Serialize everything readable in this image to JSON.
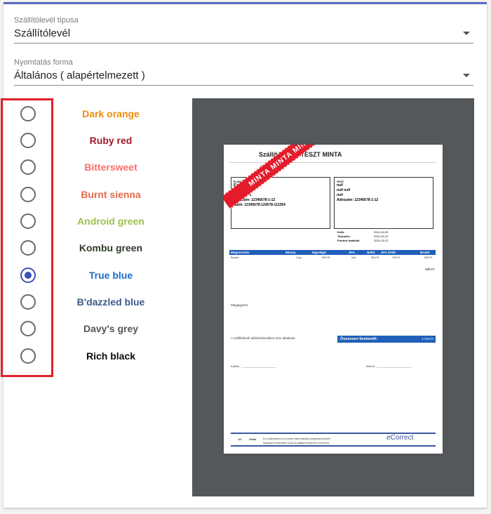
{
  "delivery_type": {
    "label": "Szállítólevél típusa",
    "value": "Szállítólevél"
  },
  "print_form": {
    "label": "Nyomtatás forma",
    "value": "Általános ( alapértelmezett )"
  },
  "colors": [
    {
      "label": "Dark orange",
      "color": "#f08a0b",
      "checked": false
    },
    {
      "label": "Ruby red",
      "color": "#9e1a2a",
      "checked": false
    },
    {
      "label": "Bittersweet",
      "color": "#fb6f6b",
      "checked": false
    },
    {
      "label": "Burnt sienna",
      "color": "#e66a4a",
      "checked": false
    },
    {
      "label": "Android green",
      "color": "#9bc34b",
      "checked": false
    },
    {
      "label": "Kombu green",
      "color": "#2e3b2a",
      "checked": false
    },
    {
      "label": "True blue",
      "color": "#1a6cc8",
      "checked": true
    },
    {
      "label": "B'dazzled blue",
      "color": "#3a5a8c",
      "checked": false
    },
    {
      "label": "Davy's grey",
      "color": "#555555",
      "checked": false
    },
    {
      "label": "Rich black",
      "color": "#0c0c0c",
      "checked": false
    }
  ],
  "preview": {
    "title": "Szállítólevél - TESZT MINTA",
    "serial_label": "SORSZÁM:",
    "ribbon": "MINTA MINTA MINTA",
    "seller": {
      "title": "ELADÓ",
      "lines": [
        "Eladom Kft",
        "1080 Szeged",
        "Fő Fasor 1",
        "Adószám: 12345678-1-12",
        "Bank: 12345678-124578-112354"
      ]
    },
    "buyer": {
      "title": "VEVŐ",
      "lines": [
        "null",
        "null null",
        "null",
        "Adószám: 12345678-1-12"
      ]
    },
    "dates": [
      {
        "k": "Kelte",
        "v": "2021-02-25"
      },
      {
        "k": "Teljesítés",
        "v": "2021-03-12"
      },
      {
        "k": "Fizetési határidő",
        "v": "2021-03-12"
      }
    ],
    "table_headers": [
      "Megnevezés",
      "Menny.",
      "Egységár",
      "ÁFA",
      "Nettó",
      "ÁFA érték",
      "Bruttó"
    ],
    "table_row": [
      "Banán",
      "1 kg",
      "500 Ft",
      "null",
      "500 Ft",
      "135 Ft",
      "635 Ft"
    ],
    "subtotal": "635 Ft",
    "remark_label": "Megjegyzés:",
    "vat_note": "A szállítólevél adóelszámolásra nem alkalmas.",
    "total_label": "Összesen fizetendő:",
    "total_value": "1 016 Ft",
    "issuer": "Kiállító : ______________________",
    "receiver": "Átvevő : ______________________",
    "page": "1/1",
    "page_word": "Oldal",
    "footer_line1": "Ez a dokumentum az eCorrect online számlázó programmal készült.",
    "footer_line2": "Számlázzon könnyedén a nap 24 órájában bárhonnan. ecorrect.hu",
    "brand": "eCorrect"
  }
}
